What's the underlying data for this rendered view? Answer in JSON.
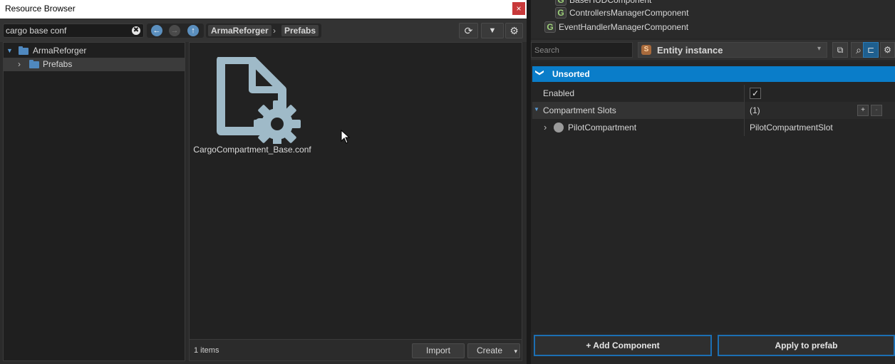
{
  "resource_browser": {
    "title": "Resource Browser",
    "close_glyph": "×",
    "search": {
      "value": "cargo base conf",
      "clear_glyph": "✖"
    },
    "nav": {
      "back_glyph": "←",
      "forward_glyph": "→",
      "up_glyph": "↑"
    },
    "breadcrumb": [
      "ArmaReforger",
      "Prefabs"
    ],
    "breadcrumb_sep": "›",
    "toolbar": {
      "refresh_glyph": "⟳",
      "filter_glyph": "▼",
      "settings_glyph": "⚙"
    },
    "tree": [
      {
        "label": "ArmaReforger",
        "arrow": "▼"
      },
      {
        "label": "Prefabs",
        "arrow": "›"
      }
    ],
    "files": [
      {
        "name": "CargoCompartment_Base.conf",
        "icon": "config-file-icon"
      }
    ],
    "status": {
      "count": "1 items",
      "import_label": "Import",
      "create_label": "Create",
      "create_caret": "▾"
    }
  },
  "component_list": [
    {
      "label": "BaseHUDComponent",
      "icon": "G"
    },
    {
      "label": "ControllersManagerComponent",
      "icon": "G"
    },
    {
      "label": "EventHandlerManagerComponent",
      "icon": "G"
    }
  ],
  "inspector": {
    "search_placeholder": "Search",
    "entity_icon": "S",
    "entity_label": "Entity instance",
    "entity_caret": "▾",
    "buttons": {
      "open_glyph": "⧉",
      "search_glyph": "⌕",
      "hierarchy_glyph": "⊏",
      "settings_glyph": "⚙"
    },
    "section": {
      "chevron": "❯",
      "label": "Unsorted"
    },
    "properties": {
      "enabled_label": "Enabled",
      "enabled_checked": "✓",
      "slots_arrow": "▼",
      "slots_label": "Compartment Slots",
      "slots_value": "(1)",
      "add_glyph": "+",
      "remove_glyph": "-",
      "pilot_arrow": "›",
      "pilot_label": "PilotCompartment",
      "pilot_value": "PilotCompartmentSlot"
    },
    "add_component_label": "+ Add Component",
    "apply_label": "Apply to prefab"
  },
  "colors": {
    "accent": "#0a7dc9",
    "folder": "#4f88bf",
    "file_icon": "#9fbac8",
    "close": "#c8393a"
  }
}
